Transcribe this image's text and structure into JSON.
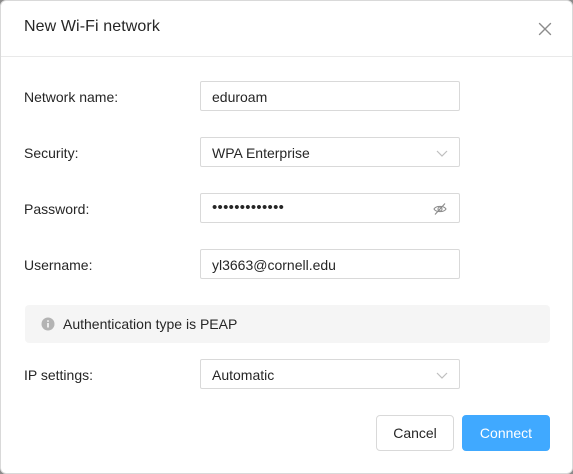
{
  "dialog": {
    "title": "New Wi-Fi network",
    "close_icon": "close-icon"
  },
  "form": {
    "network_name": {
      "label": "Network name:",
      "value": "eduroam"
    },
    "security": {
      "label": "Security:",
      "value": "WPA Enterprise",
      "icon": "chevron-down-icon"
    },
    "password": {
      "label": "Password:",
      "value": "•••••••••••••",
      "icon": "eye-hidden-icon"
    },
    "username": {
      "label": "Username:",
      "value": "yl3663@cornell.edu"
    },
    "info": {
      "text": "Authentication type is PEAP",
      "icon": "info-icon"
    },
    "ip_settings": {
      "label": "IP settings:",
      "value": "Automatic",
      "icon": "chevron-down-icon"
    }
  },
  "footer": {
    "cancel_label": "Cancel",
    "connect_label": "Connect"
  },
  "colors": {
    "primary": "#40a9ff",
    "border": "#d9d9d9",
    "text": "#262626"
  }
}
